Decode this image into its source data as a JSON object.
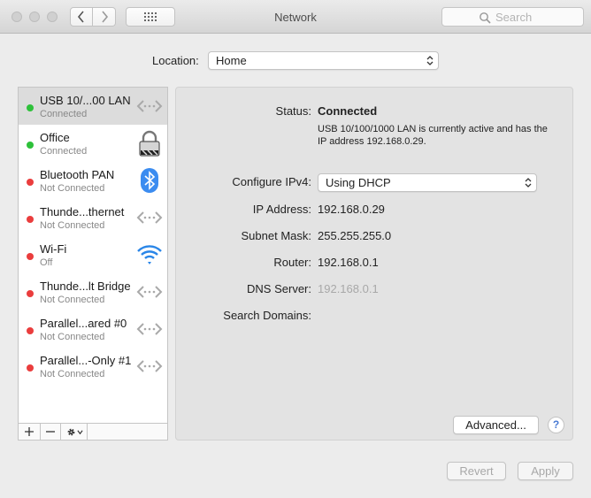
{
  "window": {
    "title": "Network"
  },
  "search": {
    "placeholder": "Search"
  },
  "location": {
    "label": "Location:",
    "value": "Home"
  },
  "services": [
    {
      "name": "USB 10/...00 LAN",
      "status": "Connected",
      "status_color": "#2ec13a",
      "icon": "ethernet-arrows-icon",
      "selected": true
    },
    {
      "name": "Office",
      "status": "Connected",
      "status_color": "#2ec13a",
      "icon": "lock-icon",
      "selected": false
    },
    {
      "name": "Bluetooth PAN",
      "status": "Not Connected",
      "status_color": "#ea3d3d",
      "icon": "bluetooth-icon",
      "selected": false
    },
    {
      "name": "Thunde...thernet",
      "status": "Not Connected",
      "status_color": "#ea3d3d",
      "icon": "ethernet-arrows-icon",
      "selected": false
    },
    {
      "name": "Wi-Fi",
      "status": "Off",
      "status_color": "#ea3d3d",
      "icon": "wifi-icon",
      "selected": false
    },
    {
      "name": "Thunde...lt Bridge",
      "status": "Not Connected",
      "status_color": "#ea3d3d",
      "icon": "ethernet-arrows-icon",
      "selected": false
    },
    {
      "name": "Parallel...ared #0",
      "status": "Not Connected",
      "status_color": "#ea3d3d",
      "icon": "ethernet-arrows-icon",
      "selected": false
    },
    {
      "name": "Parallel...-Only #1",
      "status": "Not Connected",
      "status_color": "#ea3d3d",
      "icon": "ethernet-arrows-icon",
      "selected": false
    }
  ],
  "detail": {
    "status_label": "Status:",
    "status_value": "Connected",
    "status_description": "USB 10/100/1000 LAN is currently active and has the IP address 192.168.0.29.",
    "configure_label": "Configure IPv4:",
    "configure_value": "Using DHCP",
    "ip_label": "IP Address:",
    "ip_value": "192.168.0.29",
    "subnet_label": "Subnet Mask:",
    "subnet_value": "255.255.255.0",
    "router_label": "Router:",
    "router_value": "192.168.0.1",
    "dns_label": "DNS Server:",
    "dns_value": "192.168.0.1",
    "search_domains_label": "Search Domains:",
    "advanced_label": "Advanced...",
    "help_label": "?"
  },
  "footer": {
    "revert_label": "Revert",
    "apply_label": "Apply"
  }
}
